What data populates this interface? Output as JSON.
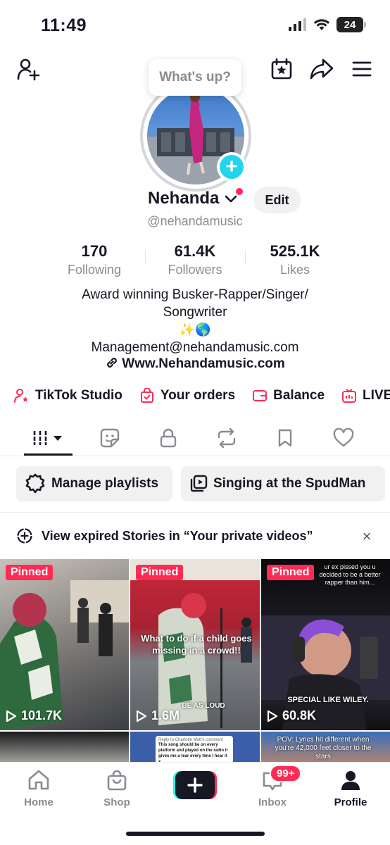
{
  "status": {
    "time": "11:49",
    "battery": "24"
  },
  "header": {
    "whats_up": "What's up?"
  },
  "profile": {
    "name": "Nehanda",
    "edit_label": "Edit",
    "handle": "@nehandamusic",
    "stats": [
      {
        "value": "170",
        "label": "Following"
      },
      {
        "value": "61.4K",
        "label": "Followers"
      },
      {
        "value": "525.1K",
        "label": "Likes"
      }
    ],
    "bio_line1": "Award winning Busker-Rapper/Singer/",
    "bio_line2": "Songwriter",
    "bio_emoji": "✨🌎",
    "bio_email": "Management@nehandamusic.com",
    "link": "Www.Nehandamusic.com"
  },
  "shortcuts": [
    {
      "label": "TikTok Studio",
      "icon": "person-star-icon"
    },
    {
      "label": "Your orders",
      "icon": "shopping-bag-check-icon"
    },
    {
      "label": "Balance",
      "icon": "wallet-icon"
    },
    {
      "label": "LIVE",
      "icon": "live-tv-icon"
    }
  ],
  "tabs": [
    {
      "name": "videos",
      "icon": "grid-bars-icon",
      "active": true
    },
    {
      "name": "stickers",
      "icon": "sticker-icon"
    },
    {
      "name": "private",
      "icon": "lock-icon"
    },
    {
      "name": "reposts",
      "icon": "repost-icon"
    },
    {
      "name": "favorites",
      "icon": "bookmark-icon"
    },
    {
      "name": "liked",
      "icon": "heart-icon"
    }
  ],
  "chips": [
    {
      "label": "Manage playlists",
      "icon": "playlist-settings-icon"
    },
    {
      "label": "Singing at the SpudMan",
      "icon": "playlist-icon"
    }
  ],
  "stories_banner": {
    "text": "View expired Stories in “Your private videos”",
    "close": "×"
  },
  "videos": [
    {
      "pinned": "Pinned",
      "views": "101.7K"
    },
    {
      "pinned": "Pinned",
      "views": "1.6M",
      "caption": "What to do if a child goes missing in a crowd!!",
      "caption2": "BE AS LOUD"
    },
    {
      "pinned": "Pinned",
      "views": "60.8K",
      "caption": "ur ex pissed you u decided to be a better rapper than him...",
      "caption2": "SPECIAL LIKE WILEY."
    }
  ],
  "videos_row2": [
    {
      "caption": "Reply to Charlotte Mott's comment",
      "caption_body": "This song should be on every platform and played on the radio it gives me a tear every time I hear it x"
    },
    {
      "caption": "POV: Lyrics hit different when you're 42,000 feet closer to the stars"
    }
  ],
  "nav": {
    "home": "Home",
    "shop": "Shop",
    "inbox": "Inbox",
    "inbox_badge": "99+",
    "profile": "Profile"
  },
  "colors": {
    "accent": "#fe2c55",
    "cyan": "#20d5ec",
    "text": "#161823",
    "muted": "#8a8b91"
  }
}
